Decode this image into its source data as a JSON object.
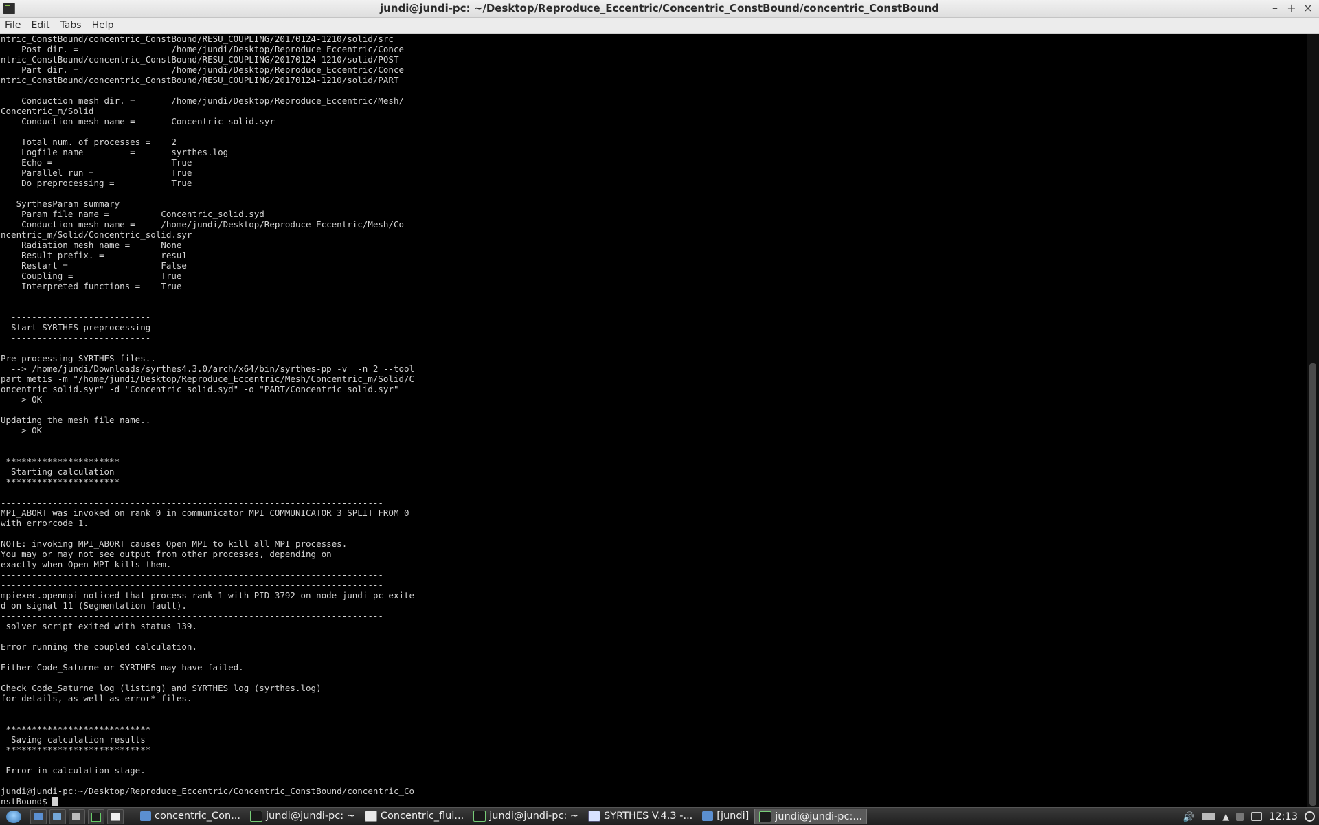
{
  "window": {
    "title": "jundi@jundi-pc: ~/Desktop/Reproduce_Eccentric/Concentric_ConstBound/concentric_ConstBound",
    "controls": {
      "minimize": "–",
      "maximize": "+",
      "close": "×"
    }
  },
  "menu": [
    "File",
    "Edit",
    "Tabs",
    "Help"
  ],
  "terminal": {
    "lines": [
      "ntric_ConstBound/concentric_ConstBound/RESU_COUPLING/20170124-1210/solid/src",
      "    Post dir. =                  /home/jundi/Desktop/Reproduce_Eccentric/Conce",
      "ntric_ConstBound/concentric_ConstBound/RESU_COUPLING/20170124-1210/solid/POST",
      "    Part dir. =                  /home/jundi/Desktop/Reproduce_Eccentric/Conce",
      "ntric_ConstBound/concentric_ConstBound/RESU_COUPLING/20170124-1210/solid/PART",
      "",
      "    Conduction mesh dir. =       /home/jundi/Desktop/Reproduce_Eccentric/Mesh/",
      "Concentric_m/Solid",
      "    Conduction mesh name =       Concentric_solid.syr",
      "",
      "    Total num. of processes =    2",
      "    Logfile name         =       syrthes.log",
      "    Echo =                       True",
      "    Parallel run =               True",
      "    Do preprocessing =           True",
      "",
      "   SyrthesParam summary",
      "    Param file name =          Concentric_solid.syd",
      "    Conduction mesh name =     /home/jundi/Desktop/Reproduce_Eccentric/Mesh/Co",
      "ncentric_m/Solid/Concentric_solid.syr",
      "    Radiation mesh name =      None",
      "    Result prefix. =           resu1",
      "    Restart =                  False",
      "    Coupling =                 True",
      "    Interpreted functions =    True",
      "",
      "",
      "  ---------------------------",
      "  Start SYRTHES preprocessing",
      "  ---------------------------",
      "",
      "Pre-processing SYRTHES files..",
      "  --> /home/jundi/Downloads/syrthes4.3.0/arch/x64/bin/syrthes-pp -v  -n 2 --tool",
      "part metis -m \"/home/jundi/Desktop/Reproduce_Eccentric/Mesh/Concentric_m/Solid/C",
      "oncentric_solid.syr\" -d \"Concentric_solid.syd\" -o \"PART/Concentric_solid.syr\"",
      "   -> OK",
      "",
      "Updating the mesh file name..",
      "   -> OK",
      "",
      "",
      " **********************",
      "  Starting calculation",
      " **********************",
      "",
      "--------------------------------------------------------------------------",
      "MPI_ABORT was invoked on rank 0 in communicator MPI COMMUNICATOR 3 SPLIT FROM 0",
      "with errorcode 1.",
      "",
      "NOTE: invoking MPI_ABORT causes Open MPI to kill all MPI processes.",
      "You may or may not see output from other processes, depending on",
      "exactly when Open MPI kills them.",
      "--------------------------------------------------------------------------",
      "--------------------------------------------------------------------------",
      "mpiexec.openmpi noticed that process rank 1 with PID 3792 on node jundi-pc exite",
      "d on signal 11 (Segmentation fault).",
      "--------------------------------------------------------------------------",
      " solver script exited with status 139.",
      "",
      "Error running the coupled calculation.",
      "",
      "Either Code_Saturne or SYRTHES may have failed.",
      "",
      "Check Code_Saturne log (listing) and SYRTHES log (syrthes.log)",
      "for details, as well as error* files.",
      "",
      "",
      " ****************************",
      "  Saving calculation results",
      " ****************************",
      "",
      " Error in calculation stage.",
      "",
      "jundi@jundi-pc:~/Desktop/Reproduce_Eccentric/Concentric_ConstBound/concentric_Co"
    ],
    "prompt_last_line": "nstBound$ "
  },
  "taskbar": {
    "tasks": [
      {
        "label": "concentric_Con...",
        "icon": "folder-icon",
        "active": false
      },
      {
        "label": "jundi@jundi-pc: ~",
        "icon": "terminal-icon",
        "active": false
      },
      {
        "label": "Concentric_flui...",
        "icon": "window-icon",
        "active": false
      },
      {
        "label": "jundi@jundi-pc: ~",
        "icon": "terminal-icon",
        "active": false
      },
      {
        "label": "SYRTHES V.4.3 -...",
        "icon": "app-icon",
        "active": false
      },
      {
        "label": "[jundi]",
        "icon": "folder-icon",
        "active": false
      },
      {
        "label": "jundi@jundi-pc:...",
        "icon": "terminal-icon",
        "active": true
      }
    ],
    "clock": "12:13"
  }
}
